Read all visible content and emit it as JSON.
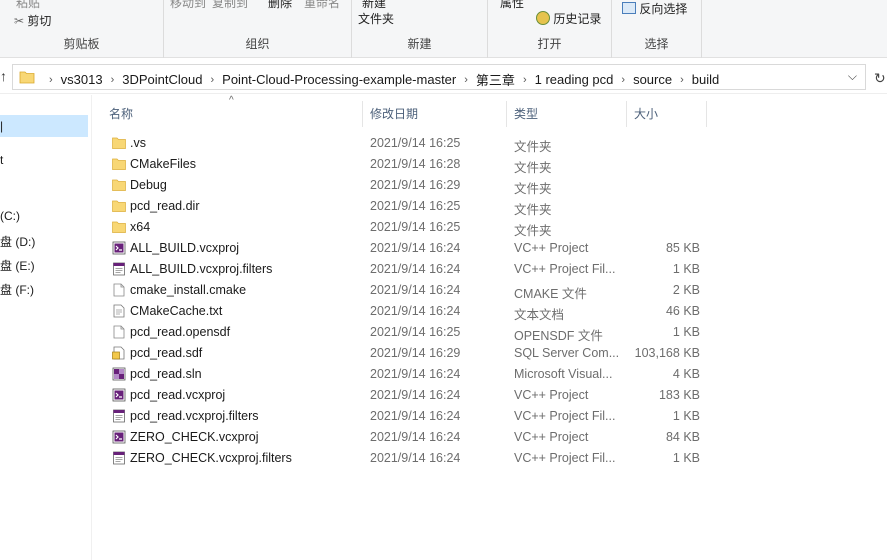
{
  "ribbon": {
    "clipboard": {
      "paste": "粘贴",
      "cut": "剪切",
      "label": "剪贴板"
    },
    "organize": {
      "move_to": "移动到",
      "copy_to": "复制到",
      "delete": "删除",
      "rename": "重命名",
      "label": "组织"
    },
    "new": {
      "new_item": "新建",
      "new_folder": "文件夹",
      "label": "新建"
    },
    "open": {
      "properties": "属性",
      "history": "历史记录",
      "label": "打开"
    },
    "select": {
      "invert": "反向选择",
      "label": "选择"
    }
  },
  "address": {
    "crumbs": [
      "vs3013",
      "3DPointCloud",
      "Point-Cloud-Processing-example-master",
      "第三章",
      "1 reading pcd",
      "source",
      "build"
    ]
  },
  "nav": {
    "items": [
      "t",
      "(C:)",
      "盘 (D:)",
      "盘 (E:)",
      "盘 (F:)"
    ]
  },
  "columns": {
    "name": "名称",
    "date": "修改日期",
    "type": "类型",
    "size": "大小"
  },
  "files": [
    {
      "name": ".vs",
      "date": "2021/9/14 16:25",
      "type": "文件夹",
      "size": "",
      "icon": "folder-icon"
    },
    {
      "name": "CMakeFiles",
      "date": "2021/9/14 16:28",
      "type": "文件夹",
      "size": "",
      "icon": "folder-icon"
    },
    {
      "name": "Debug",
      "date": "2021/9/14 16:29",
      "type": "文件夹",
      "size": "",
      "icon": "folder-icon"
    },
    {
      "name": "pcd_read.dir",
      "date": "2021/9/14 16:25",
      "type": "文件夹",
      "size": "",
      "icon": "folder-icon"
    },
    {
      "name": "x64",
      "date": "2021/9/14 16:25",
      "type": "文件夹",
      "size": "",
      "icon": "folder-icon"
    },
    {
      "name": "ALL_BUILD.vcxproj",
      "date": "2021/9/14 16:24",
      "type": "VC++ Project",
      "size": "85 KB",
      "icon": "vcxproj-icon"
    },
    {
      "name": "ALL_BUILD.vcxproj.filters",
      "date": "2021/9/14 16:24",
      "type": "VC++ Project Fil...",
      "size": "1 KB",
      "icon": "filters-icon"
    },
    {
      "name": "cmake_install.cmake",
      "date": "2021/9/14 16:24",
      "type": "CMAKE 文件",
      "size": "2 KB",
      "icon": "file-icon"
    },
    {
      "name": "CMakeCache.txt",
      "date": "2021/9/14 16:24",
      "type": "文本文档",
      "size": "46 KB",
      "icon": "text-file-icon"
    },
    {
      "name": "pcd_read.opensdf",
      "date": "2021/9/14 16:25",
      "type": "OPENSDF 文件",
      "size": "1 KB",
      "icon": "file-icon"
    },
    {
      "name": "pcd_read.sdf",
      "date": "2021/9/14 16:29",
      "type": "SQL Server Com...",
      "size": "103,168 KB",
      "icon": "sdf-icon"
    },
    {
      "name": "pcd_read.sln",
      "date": "2021/9/14 16:24",
      "type": "Microsoft Visual...",
      "size": "4 KB",
      "icon": "sln-icon"
    },
    {
      "name": "pcd_read.vcxproj",
      "date": "2021/9/14 16:24",
      "type": "VC++ Project",
      "size": "183 KB",
      "icon": "vcxproj-icon"
    },
    {
      "name": "pcd_read.vcxproj.filters",
      "date": "2021/9/14 16:24",
      "type": "VC++ Project Fil...",
      "size": "1 KB",
      "icon": "filters-icon"
    },
    {
      "name": "ZERO_CHECK.vcxproj",
      "date": "2021/9/14 16:24",
      "type": "VC++ Project",
      "size": "84 KB",
      "icon": "vcxproj-icon"
    },
    {
      "name": "ZERO_CHECK.vcxproj.filters",
      "date": "2021/9/14 16:24",
      "type": "VC++ Project Fil...",
      "size": "1 KB",
      "icon": "filters-icon"
    }
  ]
}
